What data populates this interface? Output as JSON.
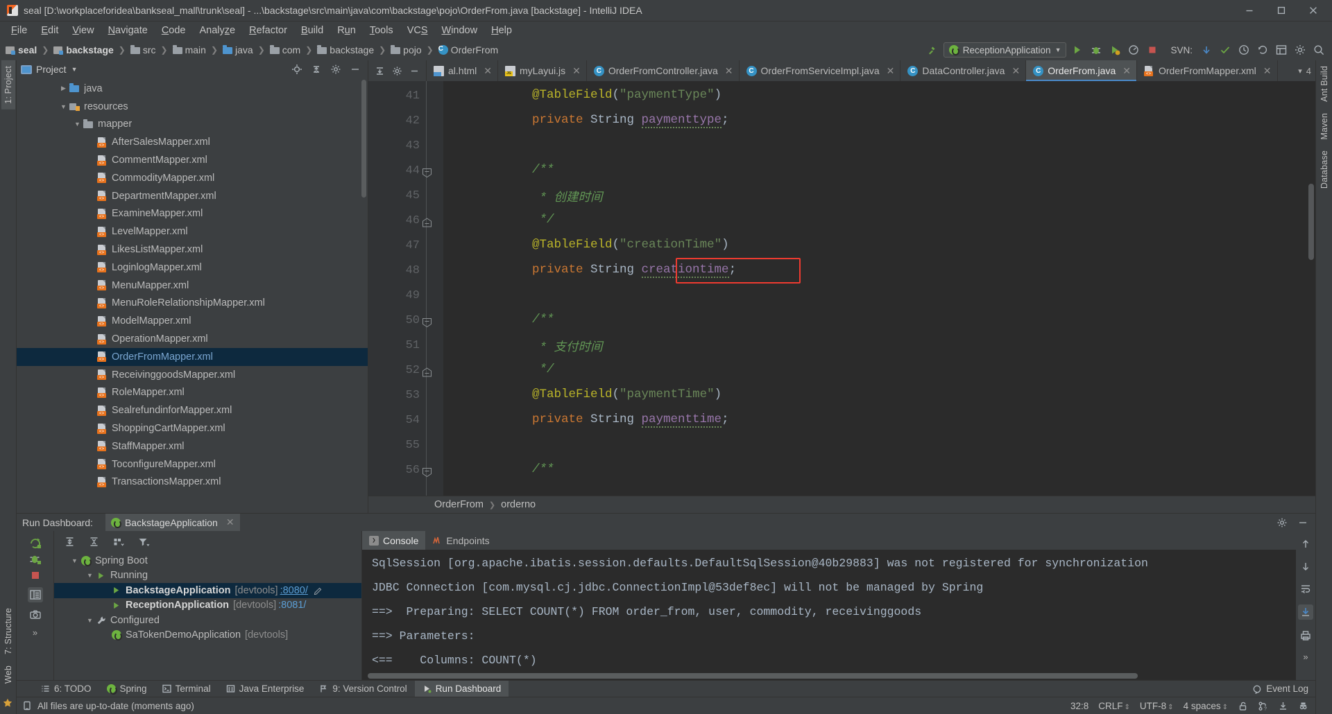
{
  "window": {
    "title": "seal [D:\\workplaceforidea\\bankseal_mall\\trunk\\seal] - ...\\backstage\\src\\main\\java\\com\\backstage\\pojo\\OrderFrom.java [backstage] - IntelliJ IDEA",
    "minimize": "–",
    "maximize": "□",
    "close": "✕"
  },
  "menu": [
    "File",
    "Edit",
    "View",
    "Navigate",
    "Code",
    "Analyze",
    "Refactor",
    "Build",
    "Run",
    "Tools",
    "VCS",
    "Window",
    "Help"
  ],
  "breadcrumbs": [
    {
      "label": "seal",
      "icon": "module-icon",
      "bold": true
    },
    {
      "label": "backstage",
      "icon": "module-icon",
      "bold": true
    },
    {
      "label": "src",
      "icon": "folder-icon",
      "bold": false
    },
    {
      "label": "main",
      "icon": "folder-icon",
      "bold": false
    },
    {
      "label": "java",
      "icon": "source-folder-icon",
      "bold": false
    },
    {
      "label": "com",
      "icon": "package-icon",
      "bold": false
    },
    {
      "label": "backstage",
      "icon": "package-icon",
      "bold": false
    },
    {
      "label": "pojo",
      "icon": "package-icon",
      "bold": false
    },
    {
      "label": "OrderFrom",
      "icon": "class-icon",
      "bold": false
    }
  ],
  "toolbar": {
    "run_config": "ReceptionApplication",
    "svn_label": "SVN:",
    "icons": [
      "build-icon",
      "run-icon",
      "debug-icon",
      "run-coverage-icon",
      "profile-icon",
      "stop-icon",
      "svn-update-icon",
      "svn-commit-icon",
      "svn-history-icon",
      "svn-revert-icon",
      "settings-icon",
      "search-everywhere-icon"
    ]
  },
  "project_panel": {
    "title": "Project",
    "tree": [
      {
        "label": "java",
        "indent": 3,
        "arrow": "collapsed",
        "icon": "source-folder-icon",
        "selected": false
      },
      {
        "label": "resources",
        "indent": 3,
        "arrow": "expanded",
        "icon": "resources-folder-icon",
        "selected": false
      },
      {
        "label": "mapper",
        "indent": 4,
        "arrow": "expanded",
        "icon": "folder-icon",
        "selected": false
      },
      {
        "label": "AfterSalesMapper.xml",
        "indent": 5,
        "arrow": "none",
        "icon": "xml-file-icon",
        "selected": false
      },
      {
        "label": "CommentMapper.xml",
        "indent": 5,
        "arrow": "none",
        "icon": "xml-file-icon",
        "selected": false
      },
      {
        "label": "CommodityMapper.xml",
        "indent": 5,
        "arrow": "none",
        "icon": "xml-file-icon",
        "selected": false
      },
      {
        "label": "DepartmentMapper.xml",
        "indent": 5,
        "arrow": "none",
        "icon": "xml-file-icon",
        "selected": false
      },
      {
        "label": "ExamineMapper.xml",
        "indent": 5,
        "arrow": "none",
        "icon": "xml-file-icon",
        "selected": false
      },
      {
        "label": "LevelMapper.xml",
        "indent": 5,
        "arrow": "none",
        "icon": "xml-file-icon",
        "selected": false
      },
      {
        "label": "LikesListMapper.xml",
        "indent": 5,
        "arrow": "none",
        "icon": "xml-file-icon",
        "selected": false
      },
      {
        "label": "LoginlogMapper.xml",
        "indent": 5,
        "arrow": "none",
        "icon": "xml-file-icon",
        "selected": false
      },
      {
        "label": "MenuMapper.xml",
        "indent": 5,
        "arrow": "none",
        "icon": "xml-file-icon",
        "selected": false
      },
      {
        "label": "MenuRoleRelationshipMapper.xml",
        "indent": 5,
        "arrow": "none",
        "icon": "xml-file-icon",
        "selected": false
      },
      {
        "label": "ModelMapper.xml",
        "indent": 5,
        "arrow": "none",
        "icon": "xml-file-icon",
        "selected": false
      },
      {
        "label": "OperationMapper.xml",
        "indent": 5,
        "arrow": "none",
        "icon": "xml-file-icon",
        "selected": false
      },
      {
        "label": "OrderFromMapper.xml",
        "indent": 5,
        "arrow": "none",
        "icon": "xml-file-icon",
        "selected": true
      },
      {
        "label": "ReceivinggoodsMapper.xml",
        "indent": 5,
        "arrow": "none",
        "icon": "xml-file-icon",
        "selected": false
      },
      {
        "label": "RoleMapper.xml",
        "indent": 5,
        "arrow": "none",
        "icon": "xml-file-icon",
        "selected": false
      },
      {
        "label": "SealrefundinforMapper.xml",
        "indent": 5,
        "arrow": "none",
        "icon": "xml-file-icon",
        "selected": false
      },
      {
        "label": "ShoppingCartMapper.xml",
        "indent": 5,
        "arrow": "none",
        "icon": "xml-file-icon",
        "selected": false
      },
      {
        "label": "StaffMapper.xml",
        "indent": 5,
        "arrow": "none",
        "icon": "xml-file-icon",
        "selected": false
      },
      {
        "label": "ToconfigureMapper.xml",
        "indent": 5,
        "arrow": "none",
        "icon": "xml-file-icon",
        "selected": false
      },
      {
        "label": "TransactionsMapper.xml",
        "indent": 5,
        "arrow": "none",
        "icon": "xml-file-icon",
        "selected": false
      }
    ]
  },
  "editor": {
    "tabs": [
      {
        "label": "al.html",
        "icon": "html-file-icon",
        "active": false
      },
      {
        "label": "myLayui.js",
        "icon": "js-file-icon",
        "active": false
      },
      {
        "label": "OrderFromController.java",
        "icon": "java-class-icon",
        "active": false
      },
      {
        "label": "OrderFromServiceImpl.java",
        "icon": "java-class-icon",
        "active": false
      },
      {
        "label": "DataController.java",
        "icon": "java-class-icon",
        "active": false
      },
      {
        "label": "OrderFrom.java",
        "icon": "java-class-icon",
        "active": true
      },
      {
        "label": "OrderFromMapper.xml",
        "icon": "xml-file-icon",
        "active": false
      }
    ],
    "tab_overflow": "4",
    "lines": [
      {
        "num": "41",
        "indent": 4,
        "fold": "none",
        "tokens": [
          {
            "t": "@TableField",
            "c": "k-ann"
          },
          {
            "t": "(",
            "c": "k-punc"
          },
          {
            "t": "\"paymentType\"",
            "c": "k-str"
          },
          {
            "t": ")",
            "c": "k-punc"
          }
        ]
      },
      {
        "num": "42",
        "indent": 4,
        "fold": "none",
        "tokens": [
          {
            "t": "private",
            "c": "k-kw"
          },
          {
            "t": " String ",
            "c": "k-type"
          },
          {
            "t": "paymenttype",
            "c": "k-field-wave"
          },
          {
            "t": ";",
            "c": "k-punc"
          }
        ]
      },
      {
        "num": "43",
        "indent": 0,
        "fold": "none",
        "tokens": []
      },
      {
        "num": "44",
        "indent": 4,
        "fold": "start",
        "tokens": [
          {
            "t": "/**",
            "c": "k-com"
          }
        ]
      },
      {
        "num": "45",
        "indent": 5,
        "fold": "none",
        "tokens": [
          {
            "t": "* 创建时间",
            "c": "k-com"
          }
        ]
      },
      {
        "num": "46",
        "indent": 5,
        "fold": "end",
        "tokens": [
          {
            "t": "*/",
            "c": "k-com"
          }
        ]
      },
      {
        "num": "47",
        "indent": 4,
        "fold": "none",
        "tokens": [
          {
            "t": "@TableField",
            "c": "k-ann"
          },
          {
            "t": "(",
            "c": "k-punc"
          },
          {
            "t": "\"creationTime\"",
            "c": "k-str"
          },
          {
            "t": ")",
            "c": "k-punc"
          }
        ]
      },
      {
        "num": "48",
        "indent": 4,
        "fold": "none",
        "highlight": true,
        "tokens": [
          {
            "t": "private",
            "c": "k-kw"
          },
          {
            "t": " String ",
            "c": "k-type"
          },
          {
            "t": "creationtime",
            "c": "k-field-wave"
          },
          {
            "t": ";",
            "c": "k-punc"
          }
        ]
      },
      {
        "num": "49",
        "indent": 0,
        "fold": "none",
        "tokens": []
      },
      {
        "num": "50",
        "indent": 4,
        "fold": "start",
        "tokens": [
          {
            "t": "/**",
            "c": "k-com"
          }
        ]
      },
      {
        "num": "51",
        "indent": 5,
        "fold": "none",
        "tokens": [
          {
            "t": "* 支付时间",
            "c": "k-com"
          }
        ]
      },
      {
        "num": "52",
        "indent": 5,
        "fold": "end",
        "tokens": [
          {
            "t": "*/",
            "c": "k-com"
          }
        ]
      },
      {
        "num": "53",
        "indent": 4,
        "fold": "none",
        "tokens": [
          {
            "t": "@TableField",
            "c": "k-ann"
          },
          {
            "t": "(",
            "c": "k-punc"
          },
          {
            "t": "\"paymentTime\"",
            "c": "k-str"
          },
          {
            "t": ")",
            "c": "k-punc"
          }
        ]
      },
      {
        "num": "54",
        "indent": 4,
        "fold": "none",
        "tokens": [
          {
            "t": "private",
            "c": "k-kw"
          },
          {
            "t": " String ",
            "c": "k-type"
          },
          {
            "t": "paymenttime",
            "c": "k-field-wave"
          },
          {
            "t": ";",
            "c": "k-punc"
          }
        ]
      },
      {
        "num": "55",
        "indent": 0,
        "fold": "none",
        "tokens": []
      },
      {
        "num": "56",
        "indent": 4,
        "fold": "start",
        "tokens": [
          {
            "t": "/**",
            "c": "k-com"
          }
        ]
      }
    ],
    "breadcrumb": [
      {
        "label": "OrderFrom"
      },
      {
        "label": "orderno"
      }
    ]
  },
  "run_dashboard": {
    "label": "Run Dashboard:",
    "tab": "BackstageApplication",
    "tree": [
      {
        "label": "Spring Boot",
        "indent": 1,
        "arrow": "expanded",
        "icon": "spring-icon",
        "bold": false,
        "selected": false
      },
      {
        "label": "Running",
        "indent": 2,
        "arrow": "expanded",
        "icon": "run-green-icon",
        "bold": false,
        "selected": false
      },
      {
        "label": "BackstageApplication",
        "indent": 3,
        "arrow": "none",
        "icon": "run-green-icon",
        "bold": true,
        "selected": true,
        "dim": "[devtools]",
        "port": ":8080/",
        "edit": true
      },
      {
        "label": "ReceptionApplication",
        "indent": 3,
        "arrow": "none",
        "icon": "run-green-icon",
        "bold": true,
        "selected": false,
        "dim": "[devtools]",
        "port": ":8081/"
      },
      {
        "label": "Configured",
        "indent": 2,
        "arrow": "expanded",
        "icon": "wrench-icon",
        "bold": false,
        "selected": false
      },
      {
        "label": "SaTokenDemoApplication",
        "indent": 3,
        "arrow": "none",
        "icon": "spring-icon",
        "bold": false,
        "selected": false,
        "dim": "[devtools]"
      }
    ],
    "console_tabs": [
      {
        "label": "Console",
        "icon": "console-icon",
        "active": true
      },
      {
        "label": "Endpoints",
        "icon": "endpoints-icon",
        "active": false
      }
    ],
    "console_lines": [
      "SqlSession [org.apache.ibatis.session.defaults.DefaultSqlSession@40b29883] was not registered for synchronization",
      "JDBC Connection [com.mysql.cj.jdbc.ConnectionImpl@53def8ec] will not be managed by Spring",
      "==>  Preparing: SELECT COUNT(*) FROM order_from, user, commodity, receivinggoods",
      "==> Parameters: ",
      "<==    Columns: COUNT(*)"
    ]
  },
  "tool_windows": [
    {
      "label": "6: TODO",
      "underline": "6",
      "icon": "todo-icon",
      "active": false
    },
    {
      "label": "Spring",
      "icon": "spring-icon",
      "active": false
    },
    {
      "label": "Terminal",
      "icon": "terminal-icon",
      "active": false
    },
    {
      "label": "Java Enterprise",
      "icon": "java-enterprise-icon",
      "active": false
    },
    {
      "label": "9: Version Control",
      "underline": "9",
      "icon": "version-control-icon",
      "active": false
    },
    {
      "label": "Run Dashboard",
      "icon": "run-dashboard-icon",
      "active": true
    }
  ],
  "event_log": "Event Log",
  "status_bar": {
    "message": "All files are up-to-date (moments ago)",
    "caret": "32:8",
    "line_sep": "CRLF",
    "encoding": "UTF-8",
    "indent": "4 spaces",
    "icons": [
      "lock-open-icon",
      "git-branch-icon",
      "download-icon",
      "inspector-icon"
    ]
  },
  "side_rails": {
    "left": [
      "1: Project",
      "7: Structure",
      "Web"
    ],
    "right": [
      "Ant Build",
      "Maven",
      "Database"
    ]
  },
  "colors": {
    "bg": "#3c3f41",
    "editor_bg": "#2b2b2b",
    "selection": "#0d293e",
    "accent": "#4a88c7",
    "highlight_box": "#ef3b30",
    "green": "#6ca644",
    "orange": "#e8721c"
  }
}
